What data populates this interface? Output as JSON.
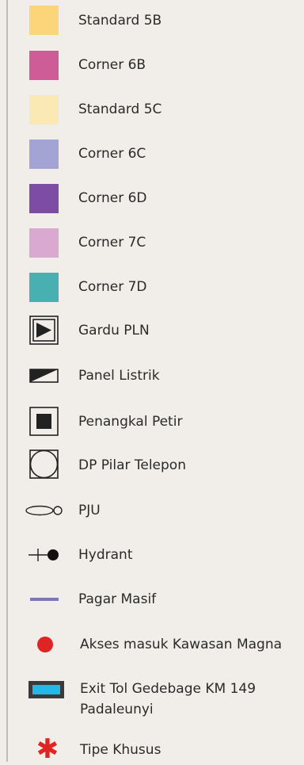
{
  "legend": {
    "items": [
      {
        "label": "Standard 5B",
        "symbol": "swatch",
        "color": "#fcd57a"
      },
      {
        "label": "Corner 6B",
        "symbol": "swatch",
        "color": "#ce5c96"
      },
      {
        "label": "Standard 5C",
        "symbol": "swatch",
        "color": "#fbe9b5"
      },
      {
        "label": "Corner 6C",
        "symbol": "swatch",
        "color": "#a4a4d4"
      },
      {
        "label": "Corner 6D",
        "symbol": "swatch",
        "color": "#7d4da5"
      },
      {
        "label": "Corner 7C",
        "symbol": "swatch",
        "color": "#d9a9d1"
      },
      {
        "label": "Corner 7D",
        "symbol": "swatch",
        "color": "#48b0b0"
      },
      {
        "label": "Gardu PLN",
        "symbol": "gardu-pln-icon"
      },
      {
        "label": "Panel Listrik",
        "symbol": "panel-listrik-icon"
      },
      {
        "label": "Penangkal Petir",
        "symbol": "penangkal-petir-icon"
      },
      {
        "label": "DP Pilar Telepon",
        "symbol": "dp-pilar-telepon-icon"
      },
      {
        "label": "PJU",
        "symbol": "pju-icon"
      },
      {
        "label": "Hydrant",
        "symbol": "hydrant-icon"
      },
      {
        "label": "Pagar Masif",
        "symbol": "pagar-masif-icon",
        "color": "#7b78b8"
      },
      {
        "label": "Akses masuk Kawasan Magna",
        "symbol": "akses-masuk-icon",
        "color": "#e02424"
      },
      {
        "label_lines": [
          "Exit Tol Gedebage KM 149",
          "Padaleunyi"
        ],
        "symbol": "exit-tol-icon",
        "color": "#22b8e8"
      },
      {
        "label": "Tipe Khusus",
        "symbol": "tipe-khusus-icon",
        "color": "#e02424"
      }
    ]
  }
}
